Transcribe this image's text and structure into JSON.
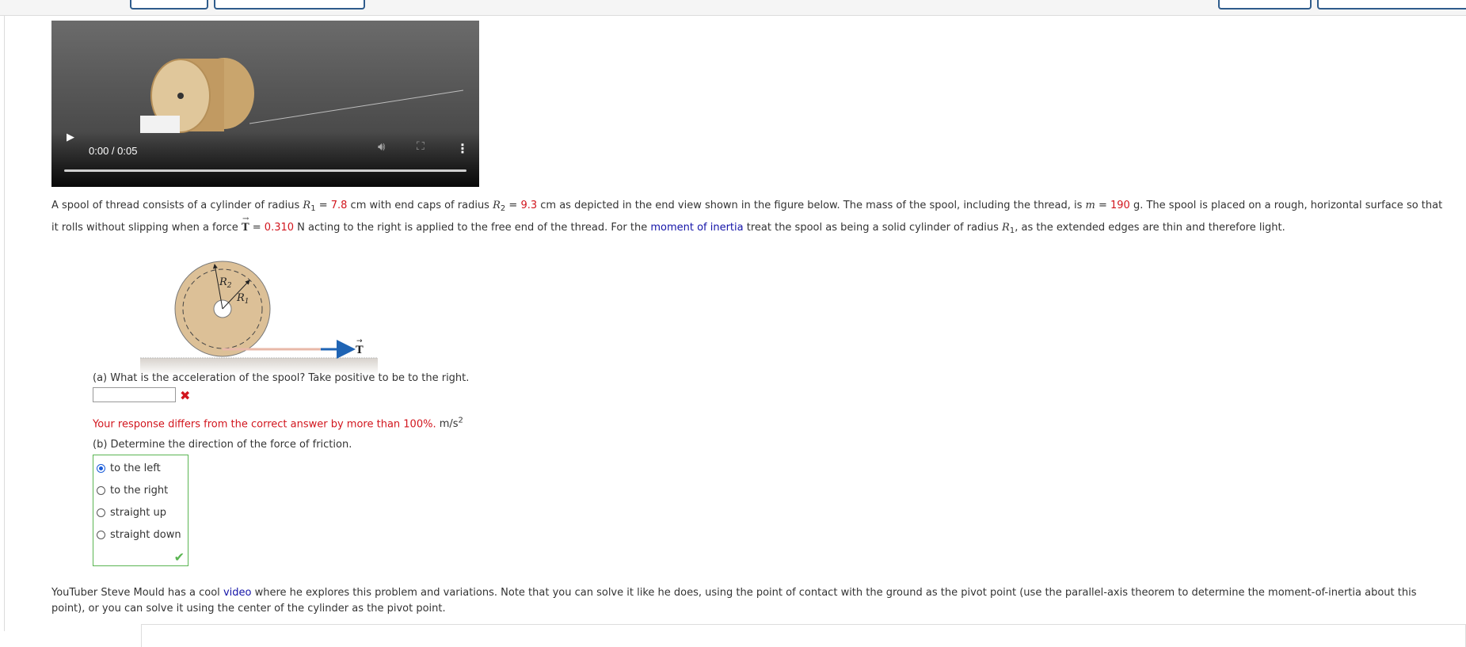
{
  "video": {
    "play_icon": "play-icon",
    "time": "0:00 / 0:05",
    "volume_icon": "volume-icon",
    "fullscreen_icon": "fullscreen-icon",
    "menu_icon": "more-vertical-icon"
  },
  "problem": {
    "s1": "A spool of thread consists of a cylinder of radius ",
    "r1_sym": "R",
    "r1_sub": "1",
    "eq1": " = ",
    "r1_val": "7.8",
    "s2": " cm with end caps of radius ",
    "r2_sym": "R",
    "r2_sub": "2",
    "eq2": " = ",
    "r2_val": "9.3",
    "s3": " cm as depicted in the end view shown in the figure below. The mass of the spool, including the thread, is ",
    "m_sym": "m",
    "eq3": " = ",
    "m_val": "190",
    "s4": " g. The spool is placed on a rough, horizontal surface so that",
    "s5": "it rolls without slipping when a force ",
    "t_sym": "T",
    "eq4": " = ",
    "t_val": "0.310",
    "s6": " N acting to the right is applied to the free end of the thread. For the ",
    "link": "moment of inertia",
    "s7": " treat the spool as being a solid cylinder of radius ",
    "r1b_sym": "R",
    "r1b_sub": "1",
    "s8": ", as the extended edges are thin and therefore light."
  },
  "figure": {
    "r2_label": "R",
    "r2_sub": "2",
    "r1_label": "R",
    "r1_sub": "1",
    "t_label": "T",
    "colors": {
      "spool": "#dcc097",
      "arrow": "#1f64b4",
      "ground": "#d7d2cc"
    }
  },
  "part_a": {
    "question": "(a) What is the acceleration of the spool? Take positive to be to the right.",
    "input_value": "",
    "status_icon": "x-mark-icon",
    "feedback": "Your response differs from the correct answer by more than 100%.",
    "unit": "m/s",
    "unit_exp": "2"
  },
  "part_b": {
    "question": "(b) Determine the direction of the force of friction.",
    "options": [
      "to the left",
      "to the right",
      "straight up",
      "straight down"
    ],
    "selected": "to the left",
    "status_icon": "check-mark-icon"
  },
  "footer": {
    "s1": "YouTuber Steve Mould has a cool ",
    "link": "video",
    "s2": " where he explores this problem and variations. Note that you can solve it like he does, using the point of contact with the ground as the pivot point (use the parallel-axis theorem to determine the moment-of-inertia about this",
    "s3": "point), or you can solve it using the center of the cylinder as the pivot point."
  }
}
